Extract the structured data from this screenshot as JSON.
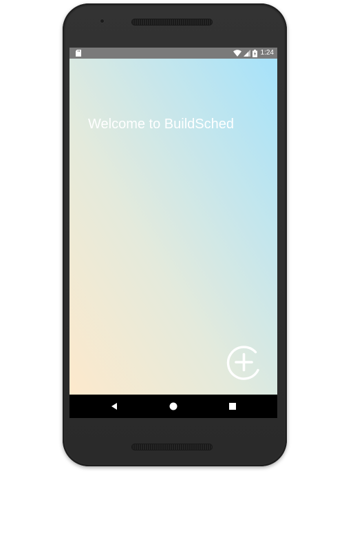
{
  "status_bar": {
    "time": "1:24",
    "icons": [
      "sd-card-icon",
      "wifi-icon",
      "cellular-signal-icon",
      "battery-charging-icon"
    ]
  },
  "main": {
    "welcome_text": "Welcome to BuildSched",
    "add_button_icon": "add-circle-icon"
  },
  "nav_bar": {
    "buttons": [
      "back-icon",
      "home-icon",
      "recents-icon"
    ]
  },
  "colors": {
    "gradient_top_right": "#a6e2fa",
    "gradient_bottom_left": "#fde9cc",
    "status_bar": "#7a7a7a",
    "nav_bar": "#000000",
    "text": "#ffffff",
    "device_body": "#2c2c2c"
  }
}
